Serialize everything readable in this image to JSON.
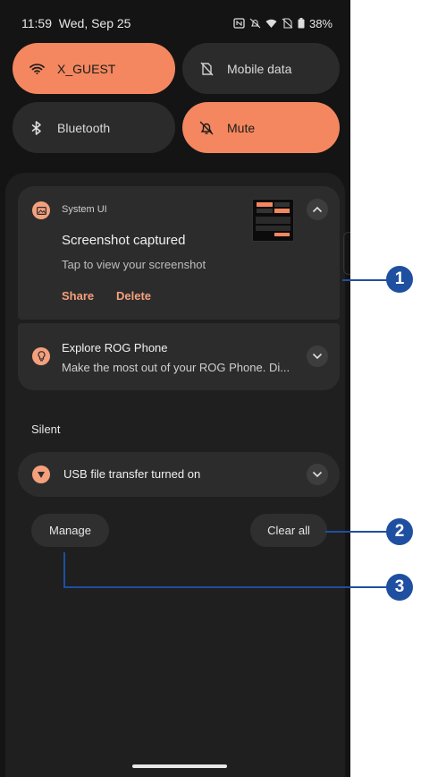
{
  "status_bar": {
    "time": "11:59",
    "date": "Wed, Sep 25",
    "battery": "38%",
    "icons": [
      "nfc-icon",
      "dnd-off-icon",
      "wifi-icon",
      "no-sim-icon",
      "battery-icon"
    ]
  },
  "quick_settings": {
    "wifi": {
      "label": "X_GUEST",
      "icon": "wifi-icon"
    },
    "mobile_data": {
      "label": "Mobile data",
      "icon": "no-sim-icon"
    },
    "bluetooth": {
      "label": "Bluetooth",
      "icon": "bluetooth-icon"
    },
    "mute": {
      "label": "Mute",
      "icon": "bell-off-icon"
    }
  },
  "notifications": {
    "screenshot": {
      "app": "System UI",
      "title": "Screenshot captured",
      "body": "Tap to view your screenshot",
      "actions": {
        "share": "Share",
        "delete": "Delete"
      }
    },
    "rog": {
      "title": "Explore ROG Phone",
      "body": "Make the most out of your ROG Phone. Di..."
    },
    "silent_header": "Silent",
    "usb": {
      "title": "USB file transfer turned on"
    }
  },
  "buttons": {
    "manage": "Manage",
    "clear_all": "Clear all"
  },
  "callouts": {
    "one": "1",
    "two": "2",
    "three": "3"
  },
  "colors": {
    "accent": "#f4875f",
    "callout": "#1f4fa0",
    "background": "#141414"
  }
}
